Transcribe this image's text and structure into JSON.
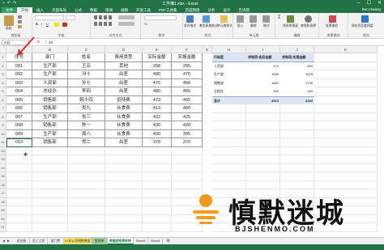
{
  "titlebar": {
    "title": "工作簿1.xlsx - Excel",
    "save_icon": "save-icon",
    "undo_icon": "undo-icon",
    "redo_icon": "redo-icon",
    "minimize": "─",
    "maximize": "☐",
    "close": "✕"
  },
  "tabs": [
    "文件",
    "开始",
    "插入",
    "页面布局",
    "公式",
    "数据",
    "审阅",
    "视图",
    "开发工具",
    "PDF工具集",
    "百度网盘",
    "分析",
    "设计",
    "告诉我"
  ],
  "active_tab_index": 1,
  "user": "Ben Hwang",
  "ribbon": {
    "groups": [
      "剪贴板",
      "字体",
      "对齐方式",
      "数字",
      "样式",
      "单元格",
      "编辑",
      "发票查验",
      "保存"
    ],
    "labels": {
      "paste": "粘贴",
      "cond_format": "条件格式",
      "table_format": "套用表格格式",
      "cell_style": "单元格样式",
      "insert": "插入",
      "delete": "删除",
      "format": "格式",
      "sort_filter": "排序和筛选",
      "find_select": "查找和选择",
      "invoice": "发票查验",
      "save_baidu": "保存到百度网盘"
    }
  },
  "formula_bar": {
    "name_box": "A11",
    "fx": "fx",
    "formula": "10"
  },
  "columns": [
    "A",
    "B",
    "C",
    "D",
    "E",
    "F",
    "G",
    "H",
    "I",
    "J",
    "K"
  ],
  "rows": [
    "1",
    "2",
    "3",
    "4",
    "5",
    "6",
    "7",
    "8",
    "9",
    "10",
    "11",
    "12",
    "13",
    "14",
    "15",
    "16",
    "17",
    "18",
    "19",
    "20",
    "21",
    "22",
    "23",
    "24",
    "25",
    "26",
    "27"
  ],
  "table": {
    "headers": [
      "序号",
      "部门",
      "姓名",
      "费用类型",
      "实际金额",
      "实报金额"
    ],
    "rows": [
      [
        "001",
        "生产部",
        "王五",
        "其他",
        "258",
        "255"
      ],
      [
        "002",
        "生产部",
        "冯十",
        "出差",
        "480",
        "470"
      ],
      [
        "003",
        "人资部",
        "孙七",
        "出差",
        "470",
        "450"
      ],
      [
        "004",
        "总经办",
        "李四",
        "出差",
        "480",
        "465"
      ],
      [
        "005",
        "销售部",
        "韩十四",
        "招待费",
        "473",
        "465"
      ],
      [
        "006",
        "销售部",
        "吴九",
        "伙食费",
        "413",
        "400"
      ],
      [
        "007",
        "生产部",
        "张三",
        "伙食费",
        "432",
        "425"
      ],
      [
        "008",
        "销售部",
        "陈一",
        "伙食费",
        "430",
        "420"
      ],
      [
        "009",
        "生产部",
        "周八",
        "伙食费",
        "400",
        "395"
      ],
      [
        "010",
        "销售部",
        "郑二",
        "出差",
        "378",
        "370"
      ]
    ]
  },
  "pivot": {
    "headers": [
      "行标签",
      "求和项:实际金额",
      "求和项:实报金额"
    ],
    "rows": [
      [
        "人资部",
        "470",
        "450"
      ],
      [
        "生产部",
        "1658",
        "1625"
      ],
      [
        "销售部",
        "1840",
        "1795"
      ],
      [
        "总经办",
        "480",
        "465"
      ]
    ],
    "total": [
      "总计",
      "4510",
      "4340"
    ]
  },
  "sheets": [
    "花名册",
    "员工工资",
    "部门费",
    "XX年公司销售数据",
    "报销单",
    "数据透视表样例",
    "Sheet5",
    "Sheet6"
  ],
  "active_sheet_index": 5,
  "watermark": {
    "brand": "慎默迷城",
    "domain": "BJSHENMO.COM"
  },
  "colors": {
    "excel_green": "#217346",
    "pivot_header": "#dde6f3",
    "arrow_red": "#d9302b"
  }
}
